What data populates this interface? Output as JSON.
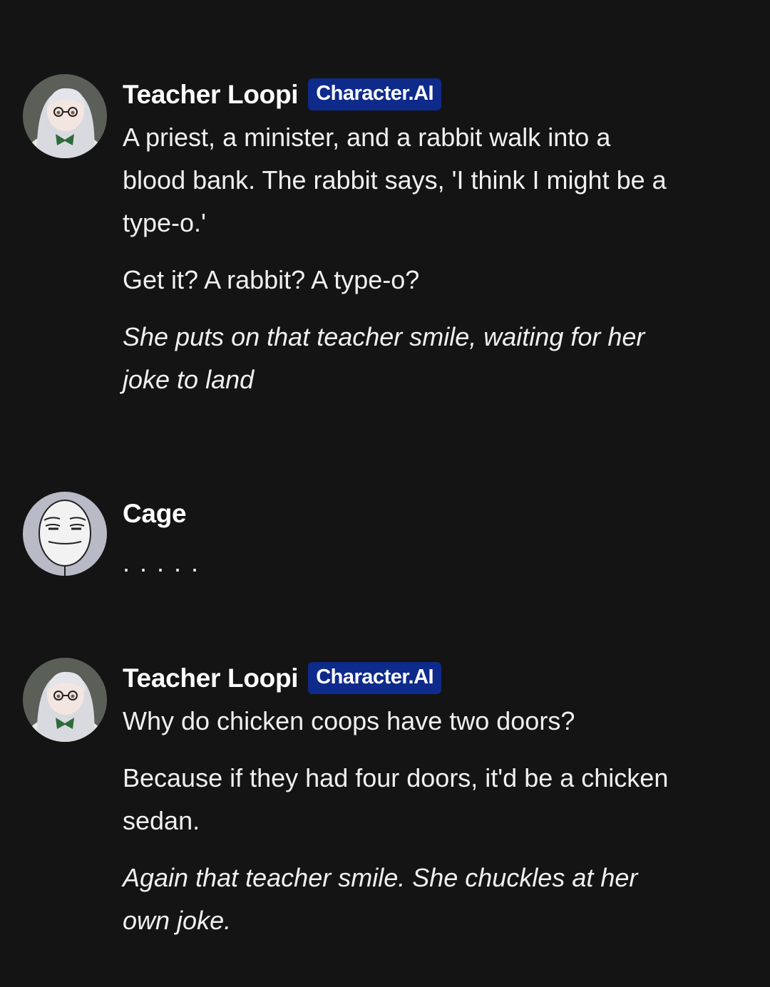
{
  "messages": [
    {
      "author": "Teacher Loopi",
      "badge": "Character.AI",
      "avatar_icon": "anime-girl-avatar",
      "paragraphs": [
        {
          "text": "A priest, a minister, and a rabbit walk into a blood bank. The rabbit says, 'I think I might be a type-o.'",
          "italic": false
        },
        {
          "text": "Get it? A rabbit? A type-o?",
          "italic": false
        },
        {
          "text": "She puts on that teacher smile, waiting for her joke to land",
          "italic": true
        }
      ]
    },
    {
      "author": "Cage",
      "avatar_icon": "meme-face-avatar",
      "paragraphs": [
        {
          "text": ". . . . .",
          "italic": false
        }
      ]
    },
    {
      "author": "Teacher Loopi",
      "badge": "Character.AI",
      "avatar_icon": "anime-girl-avatar",
      "paragraphs": [
        {
          "text": "Why do chicken coops have two doors?",
          "italic": false
        },
        {
          "text": "Because if they had four doors, it'd be a chicken sedan.",
          "italic": false
        },
        {
          "text": "Again that teacher smile. She chuckles at her own joke.",
          "italic": true
        }
      ]
    }
  ],
  "colors": {
    "background": "#141414",
    "badge": "#0e2a8a",
    "text": "#f0f0f0"
  }
}
